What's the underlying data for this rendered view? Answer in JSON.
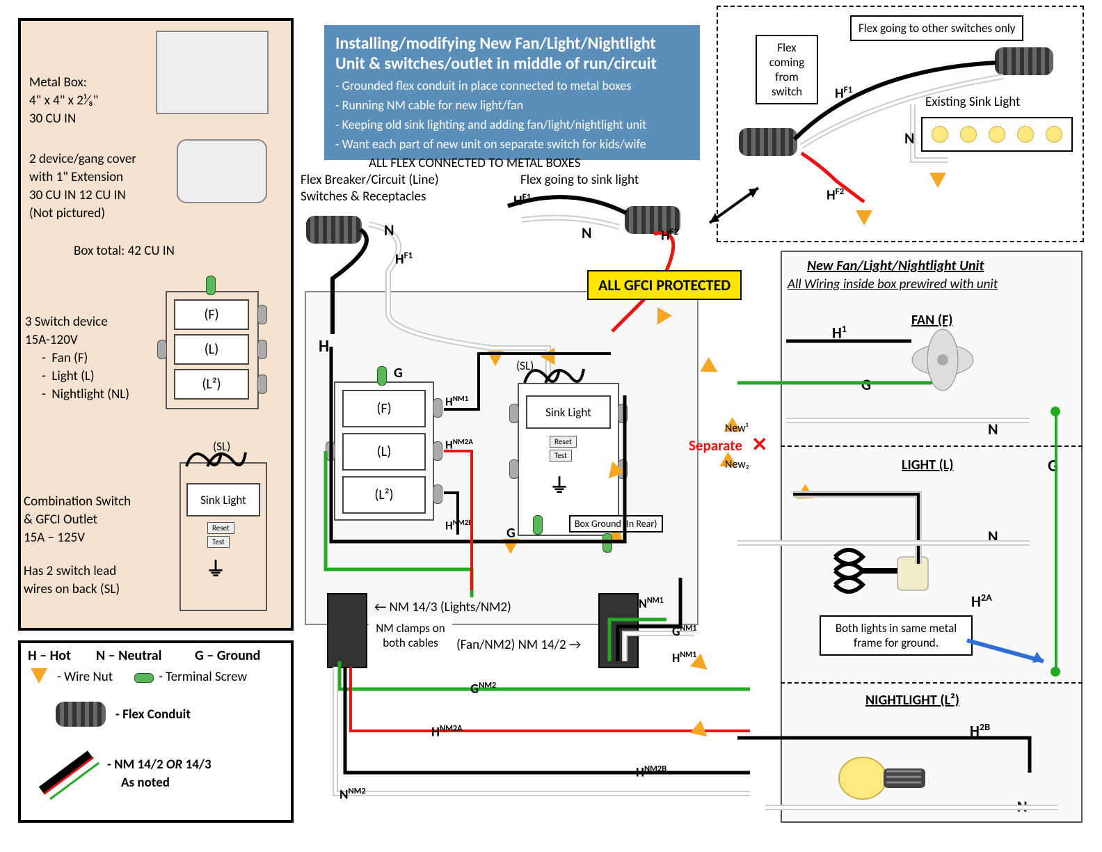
{
  "title": {
    "line1": "Installing/modifying New Fan/Light/Nightlight",
    "line2": "Unit & switches/outlet in middle of run/circuit",
    "bullets": [
      "- Grounded flex conduit in place connected to metal boxes",
      "- Running NM cable for new light/fan",
      "- Keeping old sink lighting and adding fan/light/nightlight unit",
      "- Want each part of new unit on separate switch for kids/wife"
    ]
  },
  "left_panel": {
    "metal_box_l1": "Metal Box:",
    "metal_box_l2": "4\" x 4\" x 2¹⁄₈\"",
    "metal_box_l3": "30 CU IN",
    "cover_l1": "2 device/gang cover",
    "cover_l2": "with 1\" Extension",
    "cover_l3": "30 CU IN 12 CU IN",
    "cover_l4": "(Not pictured)",
    "box_total": "Box total: 42 CU IN",
    "sw3_l1": "3 Switch device",
    "sw3_l2": "15A-120V",
    "sw3_items": [
      "-  Fan (F)",
      "-  Light (L)",
      "-  Nightlight (NL)"
    ],
    "combo_l1": "Combination Switch",
    "combo_l2": "& GFCI Outlet",
    "combo_l3": "15A – 125V",
    "combo_l4": "Has 2 switch lead",
    "combo_l5": "wires on back (SL)"
  },
  "legend": {
    "h": "H – Hot",
    "n": "N – Neutral",
    "g": "G – Ground",
    "wirenut": "- Wire Nut",
    "terminal": "- Terminal Screw",
    "flex": "- Flex Conduit",
    "nm": "- NM 14/2 OR 14/3",
    "nm2": "As noted"
  },
  "sw_labels": {
    "F": "(F)",
    "L": "(L)",
    "L2": "(L²)",
    "SL": "(SL)",
    "sink": "Sink Light",
    "reset": "Reset",
    "test": "Test"
  },
  "center": {
    "flex_boxes": "ALL FLEX CONNECTED TO METAL BOXES",
    "flex_breaker1": "Flex Breaker/Circuit (Line)",
    "flex_breaker2": "Switches & Receptacles",
    "flex_sink": "Flex going to sink light",
    "gfci": "ALL GFCI PROTECTED",
    "nm143": "← NM 14/3 (Lights/NM2)",
    "nm142": "(Fan/NM2) NM 14/2 →",
    "clamps": "NM clamps on both cables",
    "box_ground": "Box Ground (In Rear)",
    "separate": "Separate",
    "new1": "New¹",
    "new2": "New₂"
  },
  "top_right": {
    "flex_other": "Flex going to other switches only",
    "flex_from": "Flex coming from switch",
    "existing": "Existing Sink Light"
  },
  "unit": {
    "title1": "New Fan/Light/Nightlight Unit",
    "title2": "All Wiring inside box prewired with unit",
    "fan": "FAN (F)",
    "light": "LIGHT (L)",
    "night": "NIGHTLIGHT (L²)",
    "frame_note": "Both lights in same metal frame for ground."
  },
  "wire_labels": {
    "H": "H",
    "N": "N",
    "G": "G",
    "HF1": "H",
    "HF2": "H",
    "H1": "H¹",
    "H2A": "H",
    "H2B": "H",
    "HNM1": "H",
    "HNM2A": "H",
    "HNM2B": "H",
    "NNM1": "N",
    "NNM2": "N",
    "GNM1": "G",
    "GNM2": "G"
  }
}
